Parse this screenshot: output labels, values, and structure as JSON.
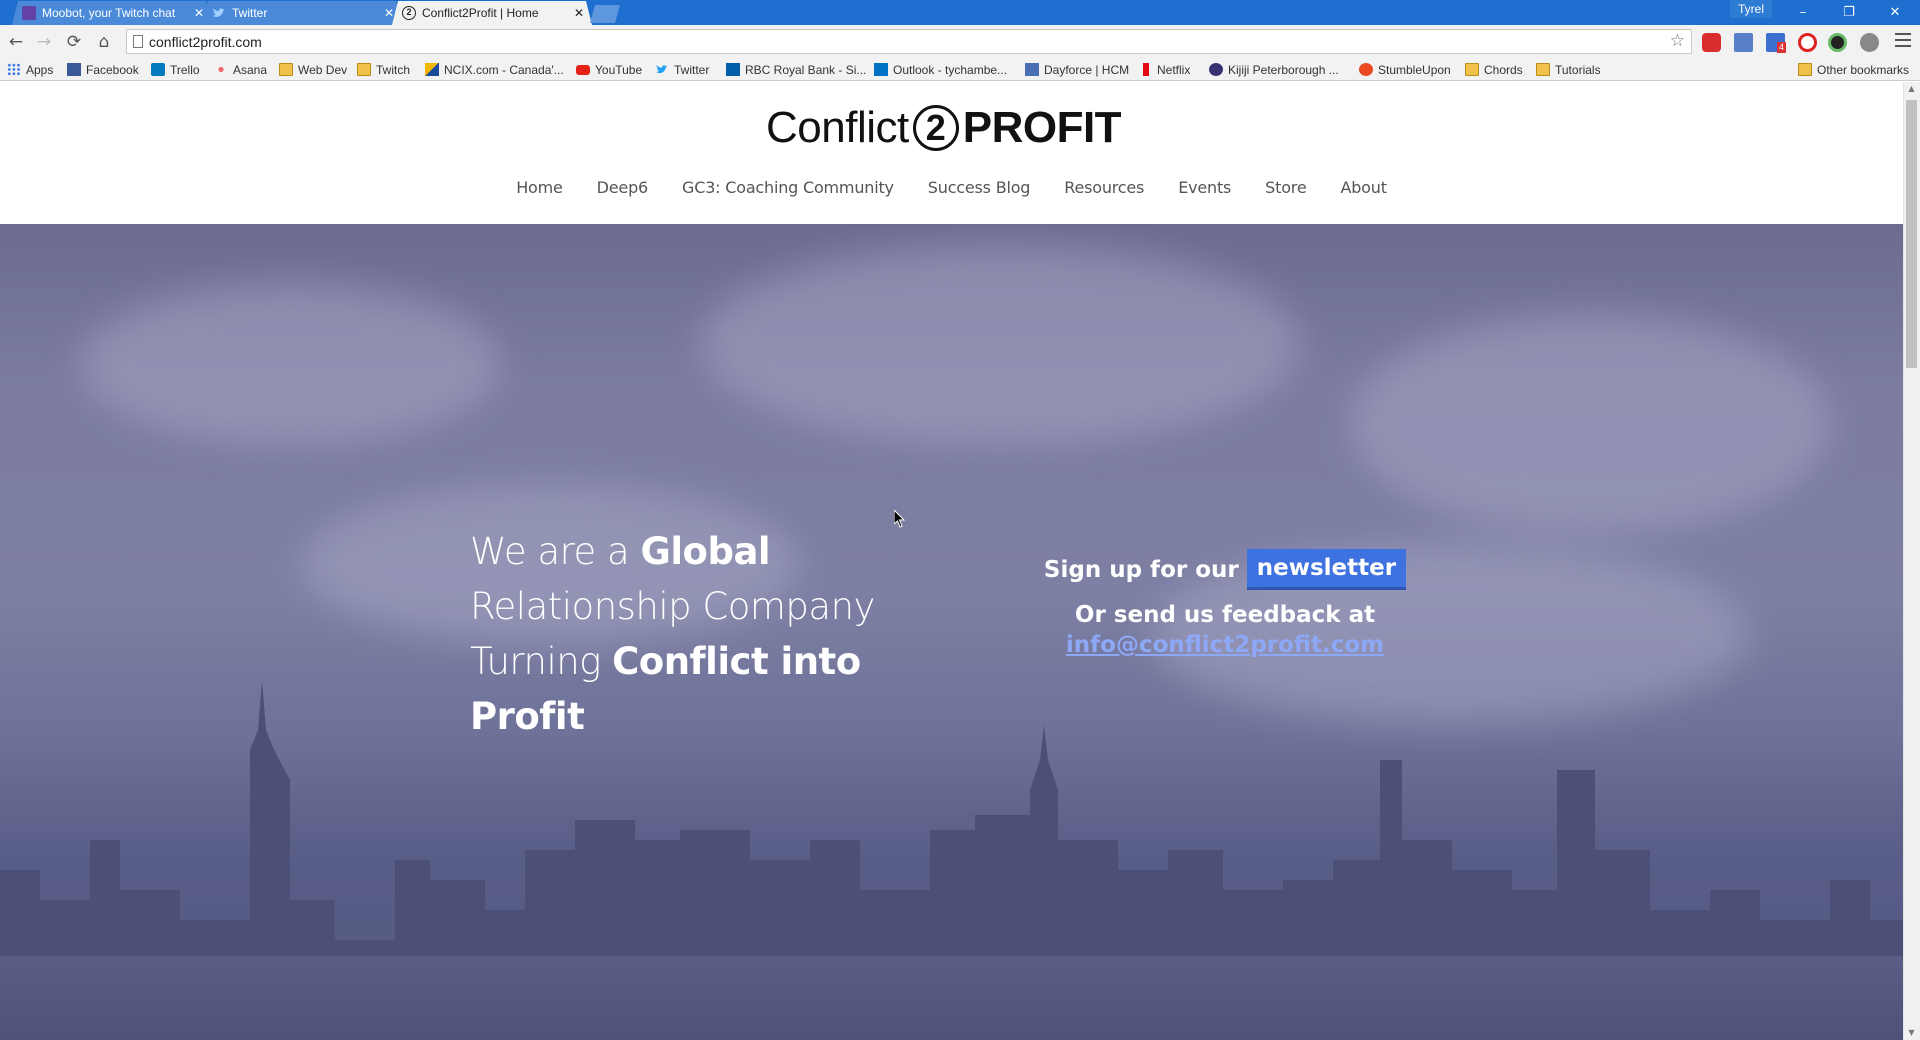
{
  "browser": {
    "tabs": [
      {
        "title": "Moobot, your Twitch chat",
        "icon": "twitch-icon"
      },
      {
        "title": "Twitter",
        "icon": "twitter-bird-icon"
      },
      {
        "title": "Conflict2Profit | Home",
        "icon": "conflict2profit-favicon"
      }
    ],
    "active_tab": 2,
    "profile_name": "Tyrel",
    "window_controls": {
      "minimize": "–",
      "restore": "❐",
      "close": "✕"
    },
    "address": "conflict2profit.com",
    "nav_glyphs": {
      "back": "←",
      "forward": "→",
      "reload": "⟳",
      "home": "⌂",
      "star": "☆"
    },
    "bookmarks": [
      {
        "label": "Apps",
        "icon": "apps-grid-icon"
      },
      {
        "label": "Facebook",
        "icon": "facebook-icon"
      },
      {
        "label": "Trello",
        "icon": "trello-icon"
      },
      {
        "label": "Asana",
        "icon": "asana-icon"
      },
      {
        "label": "Web Dev",
        "icon": "folder-icon"
      },
      {
        "label": "Twitch",
        "icon": "folder-icon"
      },
      {
        "label": "NCIX.com - Canada'...",
        "icon": "ncix-icon"
      },
      {
        "label": "YouTube",
        "icon": "youtube-icon"
      },
      {
        "label": "Twitter",
        "icon": "twitter-bird-icon"
      },
      {
        "label": "RBC Royal Bank - Si...",
        "icon": "rbc-icon"
      },
      {
        "label": "Outlook - tychambe...",
        "icon": "outlook-icon"
      },
      {
        "label": "Dayforce | HCM",
        "icon": "dayforce-icon"
      },
      {
        "label": "Netflix",
        "icon": "netflix-icon"
      },
      {
        "label": "Kijiji Peterborough ...",
        "icon": "kijiji-icon"
      },
      {
        "label": "StumbleUpon",
        "icon": "stumbleupon-icon"
      },
      {
        "label": "Chords",
        "icon": "folder-icon"
      },
      {
        "label": "Tutorials",
        "icon": "folder-icon"
      }
    ],
    "other_bookmarks": "Other bookmarks",
    "extension_icons": [
      "adblock-plus-icon",
      "calendar-extension-icon",
      "mail-checker-icon",
      "stop-record-icon",
      "dark-circle-extension-icon",
      "angular-icon"
    ],
    "mail_badge": "4",
    "colors": {
      "tabstrip": "#1e6fd0",
      "toolbar": "#f2f2f2"
    }
  },
  "site": {
    "logo": {
      "part1": "Conflict",
      "part2": "2",
      "part3": "PROFIT"
    },
    "nav": [
      "Home",
      "Deep6",
      "GC3: Coaching Community",
      "Success Blog",
      "Resources",
      "Events",
      "Store",
      "About"
    ],
    "hero": {
      "line1_light": "We are a ",
      "line1_bold": "Global",
      "line2_light": "Relationship Company",
      "line3_light": "Turning ",
      "line3_bold": "Conflict into",
      "line4_bold": "Profit"
    },
    "signup": {
      "prefix": "Sign up for our",
      "button": "newsletter",
      "feedback": "Or send us feedback at",
      "email": "info@conflict2profit.com"
    },
    "colors": {
      "newsletter_button": "#3e72e0",
      "email_link": "#8da8f7",
      "hero_overlay": "#6c6c92"
    }
  }
}
